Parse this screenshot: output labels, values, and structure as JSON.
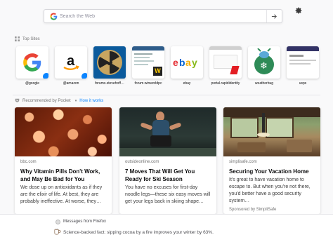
{
  "search": {
    "placeholder": "Search the Web"
  },
  "top_sites": {
    "label": "Top Sites",
    "tiles": [
      {
        "label": "@google",
        "icon": "google-logo"
      },
      {
        "label": "@amazon",
        "icon": "amazon-logo"
      },
      {
        "label": "forums.stevehoff…",
        "icon": "radiation-logo"
      },
      {
        "label": "forum.winworldpc",
        "icon": "winworld-screenshot"
      },
      {
        "label": "ebay",
        "icon": "ebay-logo"
      },
      {
        "label": "portal.rapididentity",
        "icon": "rapididentity-screenshot"
      },
      {
        "label": "weatherbug",
        "icon": "weatherbug-logo"
      },
      {
        "label": "usps",
        "icon": "usps-screenshot"
      }
    ]
  },
  "pocket": {
    "label": "Recommended by Pocket",
    "how_it_works": "How it works",
    "cards": [
      {
        "source": "bbc.com",
        "title": "Why Vitamin Pills Don't Work, and May Be Bad for You",
        "description": "We dose up on antioxidants as if they are the elixir of life. At best, they are probably ineffective. At worse, they…",
        "sponsor": ""
      },
      {
        "source": "outsideonline.com",
        "title": "7 Moves That Will Get You Ready for Ski Season",
        "description": "You have no excuses for first-day noodle legs—these six easy moves will get your legs back in skiing shape…",
        "sponsor": ""
      },
      {
        "source": "simplisafe.com",
        "title": "Securing Your Vacation Home",
        "description": "It's great to have vacation home to escape to. But when you're not there, you'd better have a good security system…",
        "sponsor": "Sponsored by SimpliSafe"
      }
    ]
  },
  "snippet": {
    "title": "Messages from Firefox",
    "text": "Science-backed fact: sipping cocoa by a fire improves your winter by 63%."
  },
  "colors": {
    "accent": "#0a84ff",
    "background": "#f9f9fa"
  }
}
